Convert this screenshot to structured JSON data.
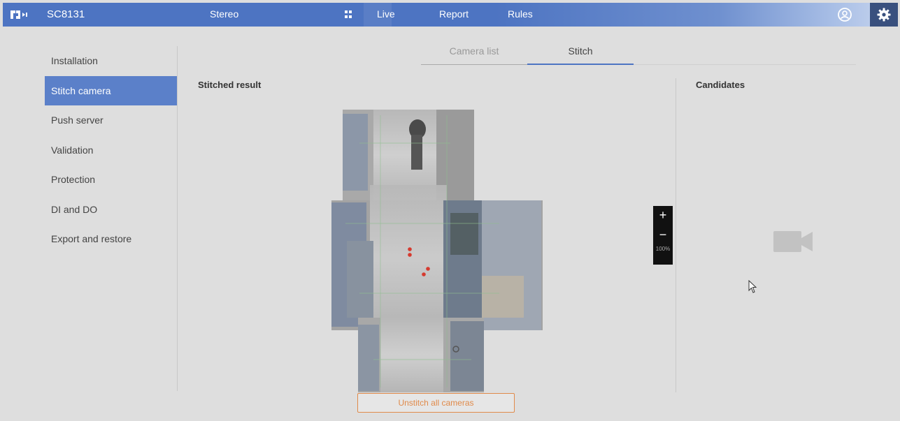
{
  "header": {
    "model": "SC8131",
    "mode": "Stereo",
    "nav": [
      "Live",
      "Report",
      "Rules"
    ],
    "icons": {
      "logo": "vivotek-logo",
      "apps": "grid-icon",
      "user": "user-icon",
      "settings": "gear-icon"
    }
  },
  "sidebar": {
    "items": [
      {
        "label": "Installation",
        "active": false
      },
      {
        "label": "Stitch camera",
        "active": true
      },
      {
        "label": "Push server",
        "active": false
      },
      {
        "label": "Validation",
        "active": false
      },
      {
        "label": "Protection",
        "active": false
      },
      {
        "label": "DI and DO",
        "active": false
      },
      {
        "label": "Export and restore",
        "active": false
      }
    ]
  },
  "tabs": [
    {
      "label": "Camera list",
      "active": false
    },
    {
      "label": "Stitch",
      "active": true
    }
  ],
  "main": {
    "stitched_title": "Stitched result",
    "candidates_title": "Candidates",
    "zoom": {
      "plus": "+",
      "minus": "−",
      "level": "100%"
    },
    "unstitch_label": "Unstitch all cameras"
  },
  "colors": {
    "accent": "#4d74c2",
    "active_item": "#5b80c9",
    "warning": "#e08a4a",
    "background": "#dedede"
  }
}
